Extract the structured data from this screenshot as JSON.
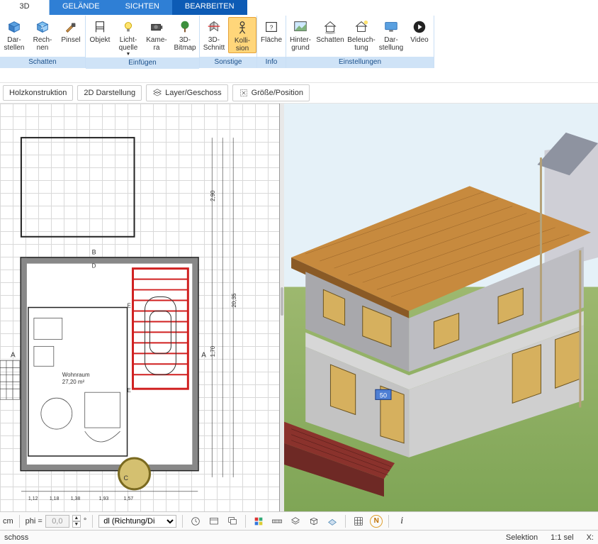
{
  "tabs": {
    "t3d": "3D",
    "gelaende": "GELÄNDE",
    "sichten": "SICHTEN",
    "bearbeiten": "BEARBEITEN"
  },
  "ribbon": {
    "groups": {
      "schatten": {
        "label": "Schatten",
        "darstellen": "Dar-\nstellen",
        "rechnen": "Rech-\nnen",
        "pinsel": "Pinsel"
      },
      "einfuegen": {
        "label": "Einfügen",
        "objekt": "Objekt",
        "lichtquelle": "Licht-\nquelle",
        "kamera": "Kame-\nra",
        "bitmap": "3D-\nBitmap"
      },
      "sonstige": {
        "label": "Sonstige",
        "schnitt": "3D-\nSchnitt",
        "kollision": "Kolli-\nsion"
      },
      "info": {
        "label": "Info",
        "flaeche": "Fläche"
      },
      "einstellungen": {
        "label": "Einstellungen",
        "hintergrund": "Hinter-\ngrund",
        "schatten2": "Schatten",
        "beleuchtung": "Beleuch-\ntung",
        "darstellung": "Dar-\nstellung",
        "video": "Video"
      }
    }
  },
  "subtoolbar": {
    "holz": "Holzkonstruktion",
    "darst2d": "2D Darstellung",
    "layer": "Layer/Geschoss",
    "groesse": "Größe/Position"
  },
  "plan": {
    "room_label": "Wohnraum",
    "room_area": "27,20 m²",
    "dims": [
      "1,12",
      "1,18",
      "1,38",
      "1,93",
      "1,57",
      "2,90",
      "20,35",
      "1,70"
    ],
    "marks": [
      "A",
      "B",
      "C",
      "D",
      "E"
    ]
  },
  "d3_overlay": "50",
  "bottombar": {
    "unit": "cm",
    "phi_label": "phi =",
    "phi_value": "0,0",
    "deg": "°",
    "dl": "dl (Richtung/Di",
    "N_badge": "N"
  },
  "statusbar": {
    "left": "schoss",
    "selektion": "Selektion",
    "scale": "1:1 sel",
    "x": "X:"
  }
}
